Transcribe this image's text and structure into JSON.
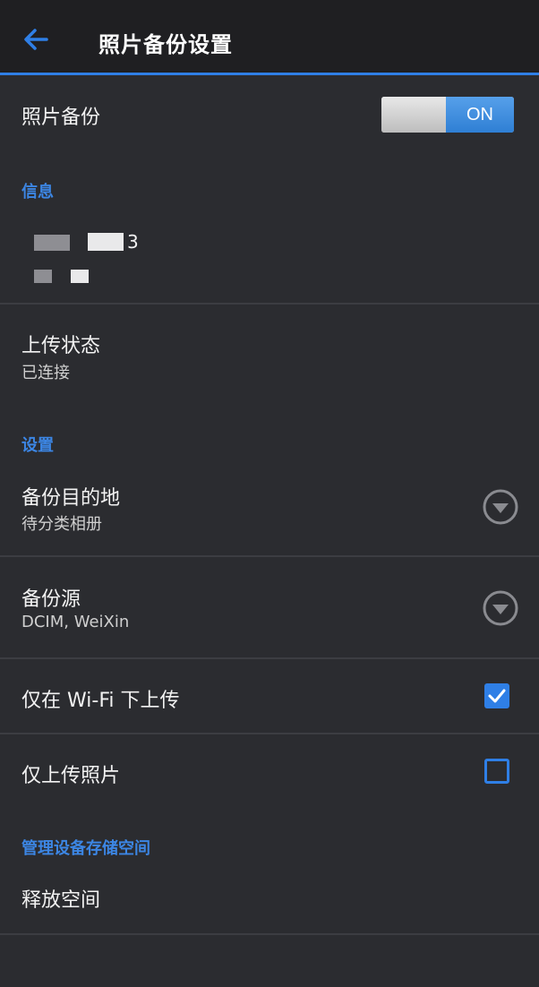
{
  "header": {
    "title": "照片备份设置"
  },
  "photo_backup": {
    "label": "照片备份",
    "toggle_state": "ON"
  },
  "info_section": {
    "title": "信息",
    "account_suffix": "3"
  },
  "upload_status": {
    "label": "上传状态",
    "value": "已连接"
  },
  "settings_section": {
    "title": "设置"
  },
  "backup_destination": {
    "label": "备份目的地",
    "value": "待分类相册"
  },
  "backup_source": {
    "label": "备份源",
    "value": "DCIM, WeiXin"
  },
  "wifi_only": {
    "label": "仅在 Wi-Fi 下上传",
    "checked": true
  },
  "photos_only": {
    "label": "仅上传照片",
    "checked": false
  },
  "storage_section": {
    "title": "管理设备存储空间"
  },
  "free_space": {
    "label": "释放空间"
  },
  "colors": {
    "accent": "#2f7fe6",
    "background": "#2b2c30",
    "header": "#1f1f22"
  }
}
